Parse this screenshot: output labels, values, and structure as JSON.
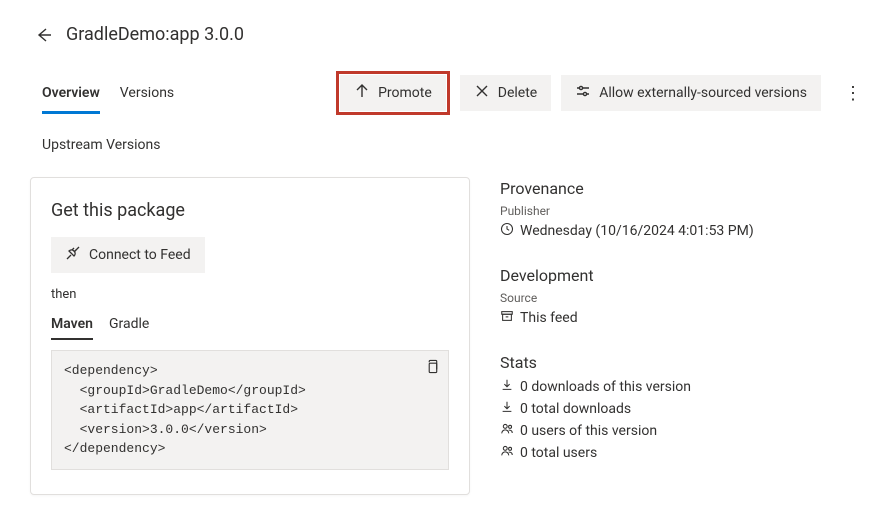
{
  "header": {
    "title": "GradleDemo:app 3.0.0"
  },
  "tabs": {
    "overview": "Overview",
    "versions": "Versions"
  },
  "actions": {
    "promote": "Promote",
    "delete": "Delete",
    "allow_external": "Allow externally-sourced versions"
  },
  "upstream_versions_label": "Upstream Versions",
  "get_package": {
    "title": "Get this package",
    "connect_button": "Connect to Feed",
    "then": "then",
    "subtabs": {
      "maven": "Maven",
      "gradle": "Gradle"
    },
    "code": "<dependency>\n  <groupId>GradleDemo</groupId>\n  <artifactId>app</artifactId>\n  <version>3.0.0</version>\n</dependency>"
  },
  "provenance": {
    "title": "Provenance",
    "publisher_label": "Publisher",
    "published_at": "Wednesday (10/16/2024 4:01:53 PM)"
  },
  "development": {
    "title": "Development",
    "source_label": "Source",
    "source_value": "This feed"
  },
  "stats": {
    "title": "Stats",
    "downloads_version": "0 downloads of this version",
    "downloads_total": "0 total downloads",
    "users_version": "0 users of this version",
    "users_total": "0 total users"
  }
}
